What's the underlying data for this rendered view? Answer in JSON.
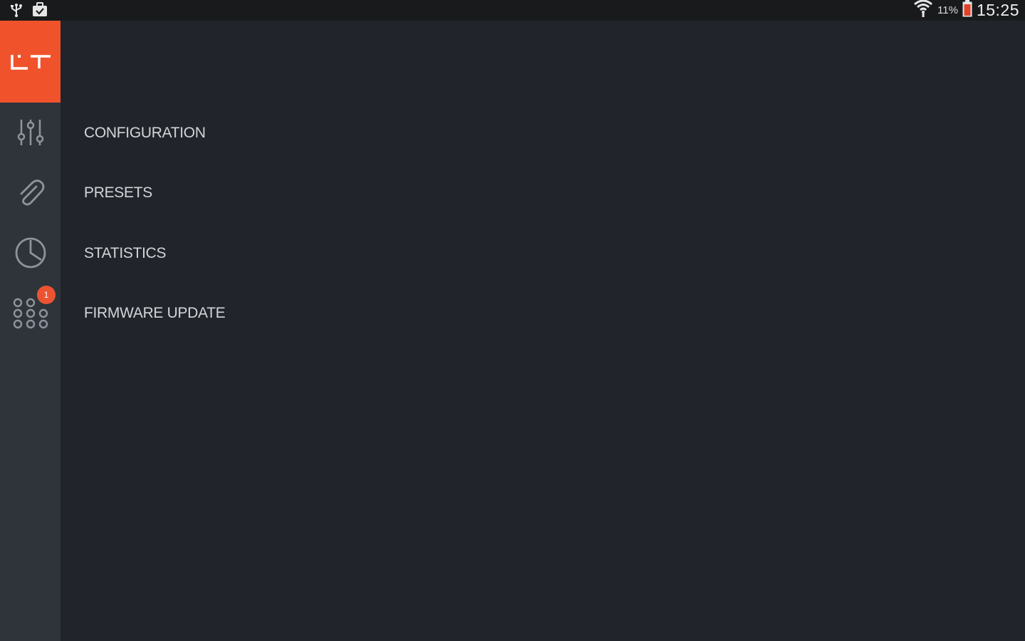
{
  "status_bar": {
    "left_icons": [
      "usb-icon",
      "briefcase-icon"
    ],
    "right_icons": [
      "wifi-icon",
      "battery-icon"
    ],
    "battery_percent": "11%",
    "time": "15:25",
    "battery_low_color": "#e2412a"
  },
  "app": {
    "brand_color": "#f0532b",
    "logo_text": "LT"
  },
  "sidebar": {
    "icons": [
      {
        "icon": "sliders-icon",
        "target": "configuration"
      },
      {
        "icon": "paperclip-icon",
        "target": "presets"
      },
      {
        "icon": "pie-chart-icon",
        "target": "statistics"
      },
      {
        "icon": "grid-dots-icon",
        "target": "firmware-update",
        "badge": "1"
      }
    ]
  },
  "menu": {
    "items": [
      {
        "label": "CONFIGURATION"
      },
      {
        "label": "PRESETS"
      },
      {
        "label": "STATISTICS"
      },
      {
        "label": "FIRMWARE UPDATE"
      }
    ]
  }
}
